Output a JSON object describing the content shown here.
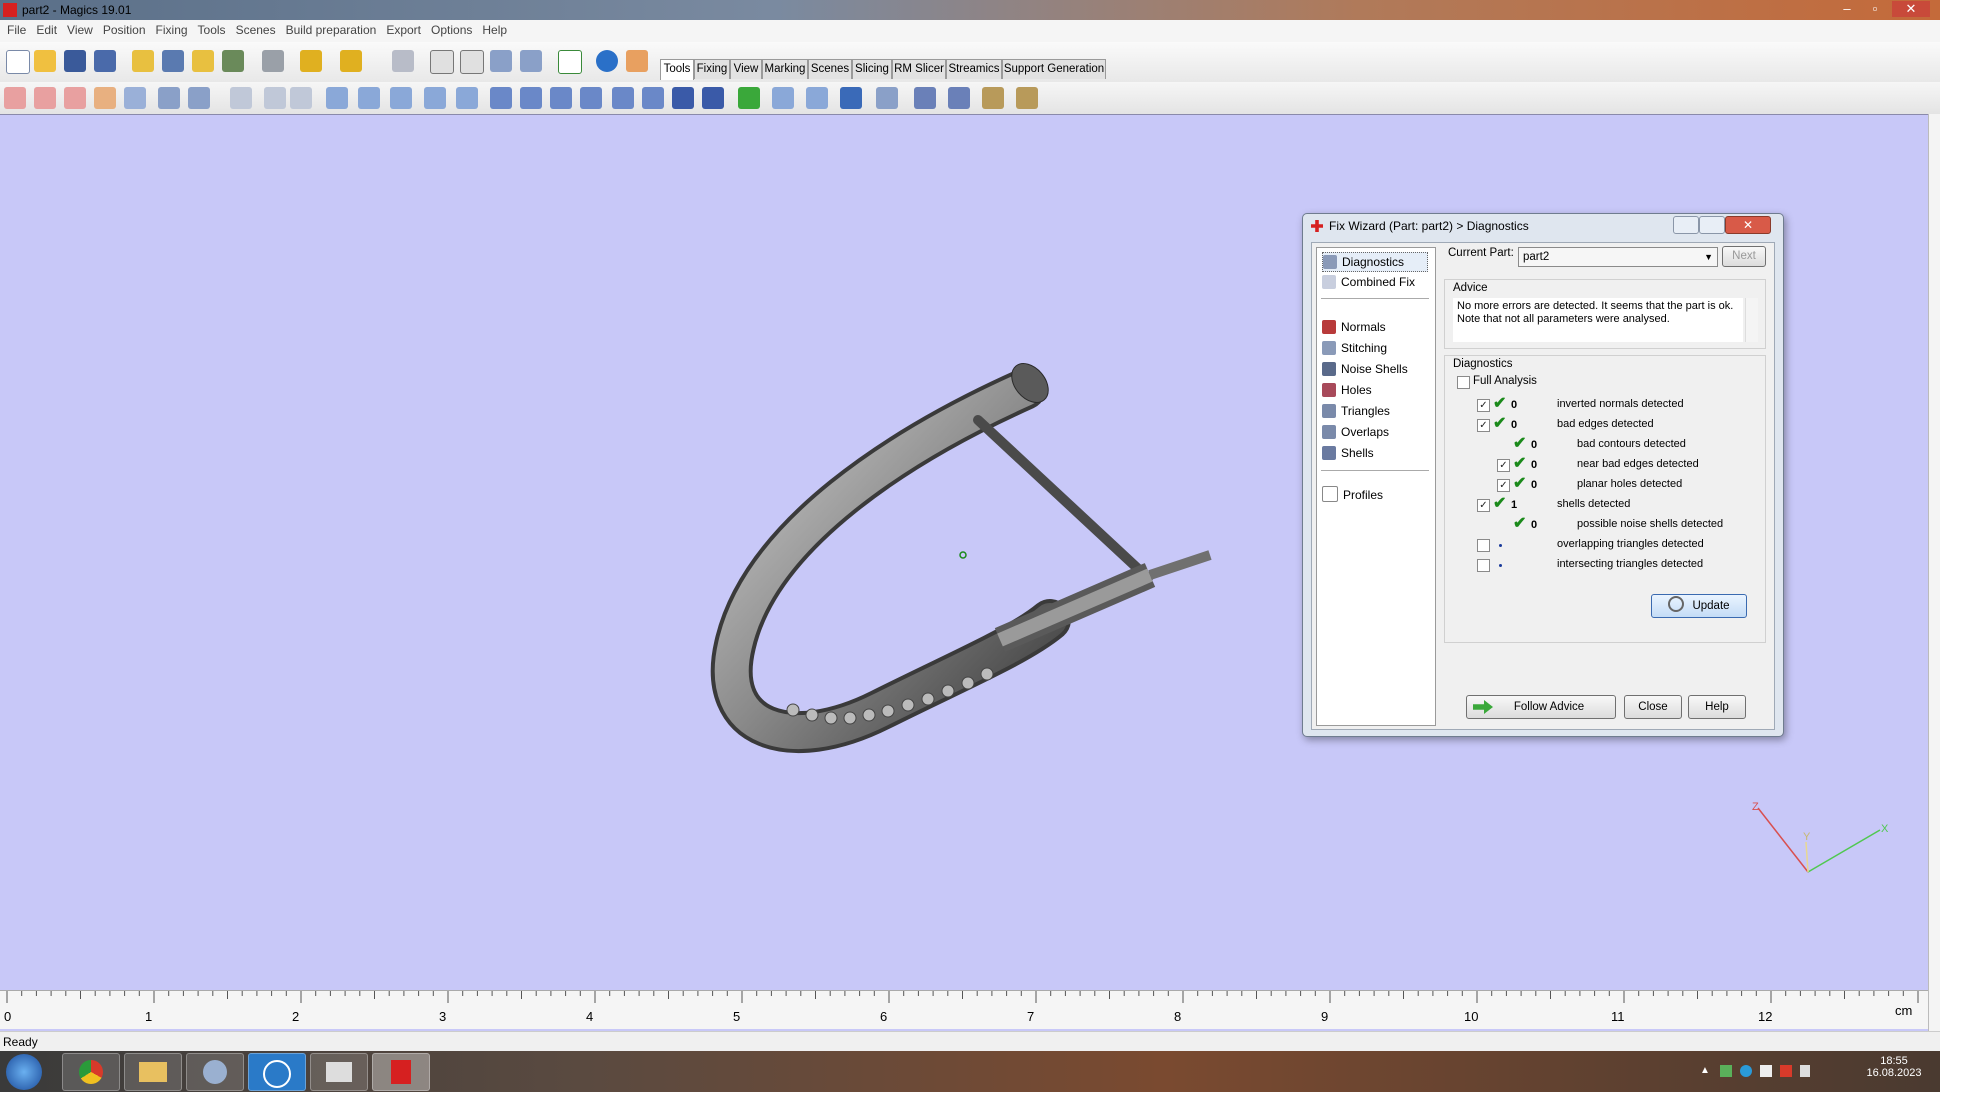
{
  "window": {
    "title": "part2 - Magics 19.01",
    "minimize": "–",
    "maximize": "▫",
    "close": "✕"
  },
  "menu": [
    "File",
    "Edit",
    "View",
    "Position",
    "Fixing",
    "Tools",
    "Scenes",
    "Build preparation",
    "Export",
    "Options",
    "Help"
  ],
  "tabs": [
    "Tools",
    "Fixing",
    "View",
    "Marking",
    "Scenes",
    "Slicing",
    "RM Slicer",
    "Streamics",
    "Support Generation"
  ],
  "ruler": {
    "labels": [
      "0",
      "1",
      "2",
      "3",
      "4",
      "5",
      "6",
      "7",
      "8",
      "9",
      "10",
      "11",
      "12"
    ],
    "unit": "cm"
  },
  "status": "Ready",
  "axes": {
    "z": "Z",
    "y": "Y",
    "x": "X"
  },
  "taskbar": {
    "time": "18:55",
    "date": "16.08.2023"
  },
  "dialog": {
    "title": "Fix Wizard (Part: part2) > Diagnostics",
    "nav_top": [
      "Diagnostics",
      "Combined Fix"
    ],
    "nav_mid": [
      "Normals",
      "Stitching",
      "Noise Shells",
      "Holes",
      "Triangles",
      "Overlaps",
      "Shells"
    ],
    "nav_bottom": [
      "Profiles"
    ],
    "current_part_label": "Current Part:",
    "current_part_value": "part2",
    "next": "Next",
    "advice_label": "Advice",
    "advice_text": "No more errors are detected. It seems that the part is ok. Note that not all parameters were analysed.",
    "diagnostics_label": "Diagnostics",
    "full_analysis": "Full Analysis",
    "rows": [
      {
        "count": "0",
        "text": "inverted normals detected"
      },
      {
        "count": "0",
        "text": "bad edges detected"
      },
      {
        "count": "0",
        "text": "bad contours detected"
      },
      {
        "count": "0",
        "text": "near bad edges detected"
      },
      {
        "count": "0",
        "text": "planar holes detected"
      },
      {
        "count": "1",
        "text": "shells detected"
      },
      {
        "count": "0",
        "text": "possible noise shells detected"
      },
      {
        "count": "",
        "text": "overlapping triangles detected"
      },
      {
        "count": "",
        "text": "intersecting triangles detected"
      }
    ],
    "update": "Update",
    "follow_advice": "Follow Advice",
    "close": "Close",
    "help": "Help"
  }
}
